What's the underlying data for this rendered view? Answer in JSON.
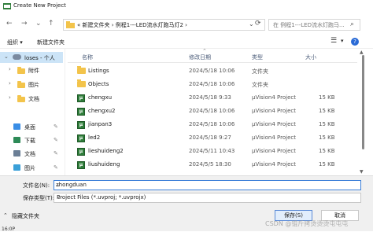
{
  "window": {
    "title": "Create New Project"
  },
  "nav": {
    "back": "←",
    "forward": "→",
    "dropdown": "⌄",
    "up": "↑"
  },
  "address": {
    "path": "«  新建文件夹  ›  例程1---LED流水灯跑马灯2  ›",
    "refresh": "⟳",
    "chevron": "⌄"
  },
  "search": {
    "placeholder": "在 例程1---LED流水灯跑马...",
    "icon": "⌕"
  },
  "toolbar": {
    "organize": "组织 ▾",
    "new_folder": "新建文件夹",
    "view_icon": "☰",
    "view_chev": "▾",
    "help": "?"
  },
  "sidebar": {
    "cloud": {
      "chevron": "⌄",
      "label": "loses - 个人"
    },
    "folders": [
      {
        "chevron": "›",
        "label": "附件"
      },
      {
        "chevron": "›",
        "label": "图片"
      },
      {
        "chevron": "›",
        "label": "文档"
      }
    ],
    "quick": [
      {
        "label": "桌面",
        "color": "#3a8ee6"
      },
      {
        "label": "下载",
        "color": "#2d8a57"
      },
      {
        "label": "文档",
        "color": "#6b7f96"
      },
      {
        "label": "图片",
        "color": "#3aa0d8"
      }
    ],
    "pin": "✎"
  },
  "columns": {
    "name": "名称",
    "date": "修改日期",
    "type": "类型",
    "size": "大小",
    "sort_arrow": "⌃"
  },
  "files": [
    {
      "icon": "folder",
      "name": "Listings",
      "date": "2024/5/18 10:06",
      "type": "文件夹",
      "size": ""
    },
    {
      "icon": "folder",
      "name": "Objects",
      "date": "2024/5/18 10:06",
      "type": "文件夹",
      "size": ""
    },
    {
      "icon": "project",
      "name": "chengxu",
      "date": "2024/5/18 9:33",
      "type": "µVision4 Project",
      "size": "15 KB"
    },
    {
      "icon": "project",
      "name": "chengxu2",
      "date": "2024/5/18 10:06",
      "type": "µVision4 Project",
      "size": "15 KB"
    },
    {
      "icon": "project",
      "name": "jianpan3",
      "date": "2024/5/18 10:06",
      "type": "µVision4 Project",
      "size": "15 KB"
    },
    {
      "icon": "project",
      "name": "led2",
      "date": "2024/5/18 9:27",
      "type": "µVision4 Project",
      "size": "15 KB"
    },
    {
      "icon": "project",
      "name": "lieshuideng2",
      "date": "2024/5/11 10:43",
      "type": "µVision4 Project",
      "size": "15 KB"
    },
    {
      "icon": "project",
      "name": "liushuideng",
      "date": "2024/5/5 18:30",
      "type": "µVision4 Project",
      "size": "15 KB"
    }
  ],
  "bottom": {
    "filename_label": "文件名(N):",
    "filename_value": "zhongduan",
    "filetype_label": "保存类型(T):",
    "filetype_value": "Project Files (*.uvproj; *.uvprojx)",
    "dropdown_chev": "⌄",
    "hide_folders": "隐藏文件夹",
    "hide_chevron": "⌃",
    "save": "保存(S)",
    "cancel": "取消",
    "cursor_text": "16:0P",
    "watermark": "CSDN @锟斤拷烫烫烫屯屯屯"
  }
}
